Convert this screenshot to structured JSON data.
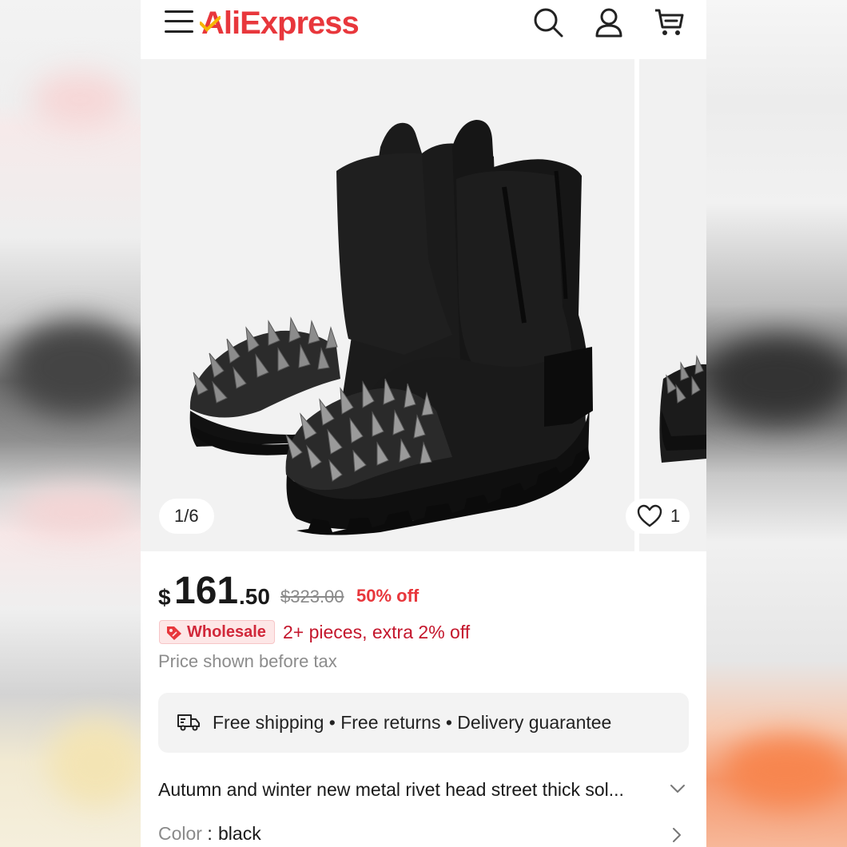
{
  "app": {
    "logo": "AliExpress",
    "brand_color": "#e8373c"
  },
  "header": {
    "icons": [
      "menu-icon",
      "search-icon",
      "account-icon",
      "cart-icon"
    ]
  },
  "gallery": {
    "counter": "1/6",
    "wishlist_count": "1",
    "image": "black-suede-ankle-boots-with-metal-spikes"
  },
  "price": {
    "currency": "$",
    "integer": "161",
    "decimal": ".50",
    "original": "$323.00",
    "discount": "50% off"
  },
  "wholesale": {
    "badge": "Wholesale",
    "offer": "2+ pieces, extra 2% off"
  },
  "tax_note": "Price shown before tax",
  "shipping": {
    "text": "Free shipping • Free returns • Delivery guarantee"
  },
  "product": {
    "title": "Autumn and winter new metal rivet head street thick sol..."
  },
  "color": {
    "label": "Color",
    "separator": " : ",
    "value": "black"
  },
  "colors": {
    "discount": "#e8373c",
    "wholesale": "#c4162c",
    "muted": "#8a8a8a"
  }
}
